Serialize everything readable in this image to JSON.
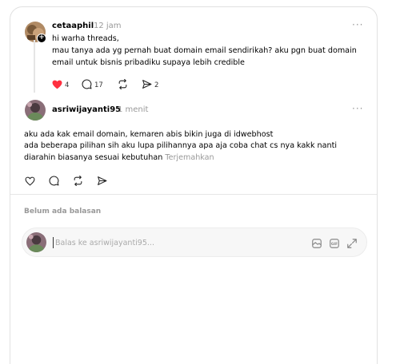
{
  "original_post": {
    "username": "cetaaphil",
    "time": "12 jam",
    "more": "···",
    "lines": [
      "hi warha threads,",
      "mau tanya ada yg pernah buat domain email sendirikah? aku pgn buat domain",
      "email untuk bisnis pribadiku supaya lebih credible"
    ],
    "likes": "4",
    "comments": "17",
    "shares": "2"
  },
  "reply": {
    "username": "asriwijayanti95",
    "time": "1 menit",
    "more": "···",
    "lines": [
      "aku ada kak email domain, kemaren abis bikin juga di idwebhost",
      "ada beberapa pilihan sih aku lupa pilihannya apa aja coba chat cs nya kakk nanti",
      "diarahin biasanya sesuai kebutuhan"
    ],
    "translate": "Terjemahkan"
  },
  "no_replies": "Belum ada balasan",
  "composer": {
    "placeholder": "Balas ke asriwijayanti95..."
  },
  "colors": {
    "like_red": "#ff3040",
    "muted": "#999999"
  }
}
